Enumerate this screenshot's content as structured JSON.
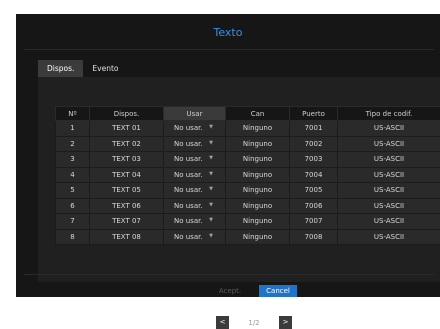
{
  "dialog": {
    "title": "Texto"
  },
  "tabs": [
    {
      "label": "Dispos."
    },
    {
      "label": "Evento"
    }
  ],
  "table": {
    "headers": [
      "Nº",
      "Dispos.",
      "Usar",
      "Can",
      "Puerto",
      "Tipo de codif."
    ],
    "rows": [
      [
        "1",
        "TEXT 01",
        "No usar.",
        "Ninguno",
        "7001",
        "US-ASCII"
      ],
      [
        "2",
        "TEXT 02",
        "No usar.",
        "Ninguno",
        "7002",
        "US-ASCII"
      ],
      [
        "3",
        "TEXT 03",
        "No usar.",
        "Ninguno",
        "7003",
        "US-ASCII"
      ],
      [
        "4",
        "TEXT 04",
        "No usar.",
        "Ninguno",
        "7004",
        "US-ASCII"
      ],
      [
        "5",
        "TEXT 05",
        "No usar.",
        "Ninguno",
        "7005",
        "US-ASCII"
      ],
      [
        "6",
        "TEXT 06",
        "No usar.",
        "Ninguno",
        "7006",
        "US-ASCII"
      ],
      [
        "7",
        "TEXT 07",
        "No usar.",
        "Ninguno",
        "7007",
        "US-ASCII"
      ],
      [
        "8",
        "TEXT 08",
        "No usar.",
        "Ninguno",
        "7008",
        "US-ASCII"
      ]
    ]
  },
  "pager": {
    "prev_icon": "chevron-left-icon",
    "next_icon": "chevron-right-icon",
    "page": "1/2"
  },
  "buttons": {
    "accept_label": "Acept.",
    "cancel_label": "Cancel"
  },
  "colors": {
    "accent": "#3d8fe0",
    "primary_button": "#1f73c9",
    "background": "#161616"
  }
}
